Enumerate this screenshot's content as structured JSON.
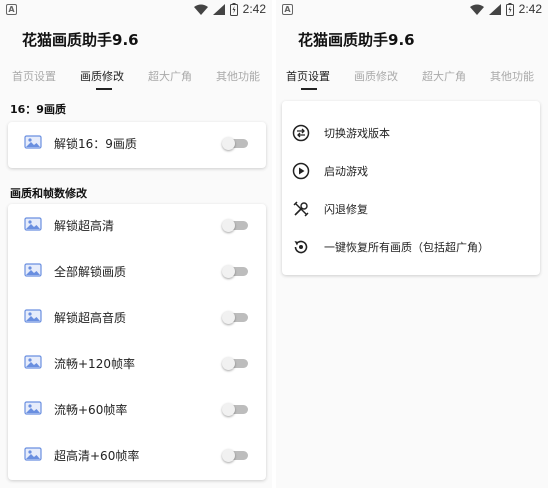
{
  "status_bar": {
    "time": "2:42",
    "app_icon_letter": "A"
  },
  "left_screen": {
    "app_title": "花猫画质助手9.6",
    "tabs": [
      {
        "label": "首页设置",
        "active": false
      },
      {
        "label": "画质修改",
        "active": true
      },
      {
        "label": "超大广角",
        "active": false
      },
      {
        "label": "其他功能",
        "active": false
      }
    ],
    "section1": {
      "title": "16：9画质",
      "items": [
        {
          "label": "解锁16：9画质",
          "on": false
        }
      ]
    },
    "section2": {
      "title": "画质和帧数修改",
      "items": [
        {
          "label": "解锁超高清",
          "on": false
        },
        {
          "label": "全部解锁画质",
          "on": false
        },
        {
          "label": "解锁超高音质",
          "on": false
        },
        {
          "label": "流畅+120帧率",
          "on": false
        },
        {
          "label": "流畅+60帧率",
          "on": false
        },
        {
          "label": "超高清+60帧率",
          "on": false
        }
      ]
    }
  },
  "right_screen": {
    "app_title": "花猫画质助手9.6",
    "tabs": [
      {
        "label": "首页设置",
        "active": true
      },
      {
        "label": "画质修改",
        "active": false
      },
      {
        "label": "超大广角",
        "active": false
      },
      {
        "label": "其他功能",
        "active": false
      }
    ],
    "menu": [
      {
        "label": "切换游戏版本",
        "icon": "swap-icon"
      },
      {
        "label": "启动游戏",
        "icon": "play-icon"
      },
      {
        "label": "闪退修复",
        "icon": "tools-icon"
      },
      {
        "label": "一键恢复所有画质（包括超广角）",
        "icon": "restore-icon"
      }
    ]
  },
  "colors": {
    "toggle_track": "#bdbdbd",
    "toggle_thumb": "#f1f1f1",
    "active_tab": "#222222",
    "inactive_tab": "#aaaaaa",
    "icon_blue": "#6a8fe0"
  }
}
